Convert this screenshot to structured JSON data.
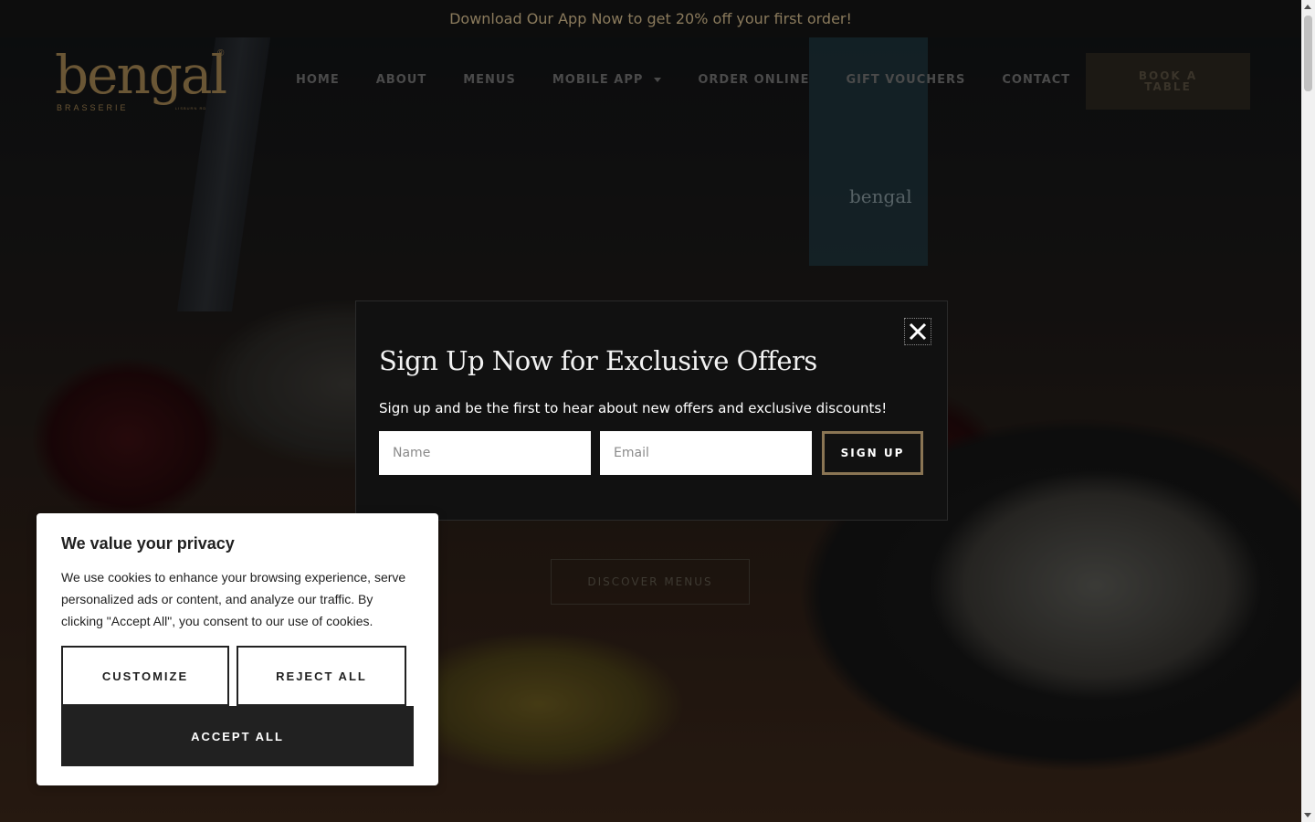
{
  "topbar": {
    "promo_text": "Download Our App Now to get 20% off your first order!"
  },
  "header": {
    "logo": {
      "word": "bengal",
      "sub": "BRASSERIE",
      "location": "LISBURN RD",
      "reg": "®"
    },
    "nav": [
      {
        "label": "HOME"
      },
      {
        "label": "ABOUT"
      },
      {
        "label": "MENUS"
      },
      {
        "label": "MOBILE APP",
        "has_dropdown": true
      },
      {
        "label": "ORDER ONLINE"
      },
      {
        "label": "GIFT VOUCHERS"
      },
      {
        "label": "CONTACT"
      }
    ],
    "book_button": "BOOK A TABLE"
  },
  "hero": {
    "discover_button": "DISCOVER MENUS",
    "standee_text": "bengal"
  },
  "signup_modal": {
    "title": "Sign Up Now for Exclusive Offers",
    "description": "Sign up and be the first to hear about new offers and exclusive discounts!",
    "name_placeholder": "Name",
    "email_placeholder": "Email",
    "submit_label": "SIGN UP",
    "close_icon": "close-icon"
  },
  "cookie_banner": {
    "title": "We value your privacy",
    "text": "We use cookies to enhance your browsing experience, serve personalized ads or content, and analyze our traffic. By clicking \"Accept All\", you consent to our use of cookies.",
    "customize_label": "CUSTOMIZE",
    "reject_label": "REJECT ALL",
    "accept_label": "ACCEPT ALL"
  },
  "colors": {
    "brand_gold": "#8a7554",
    "modal_bg": "#111111",
    "cookie_dark": "#212121"
  }
}
